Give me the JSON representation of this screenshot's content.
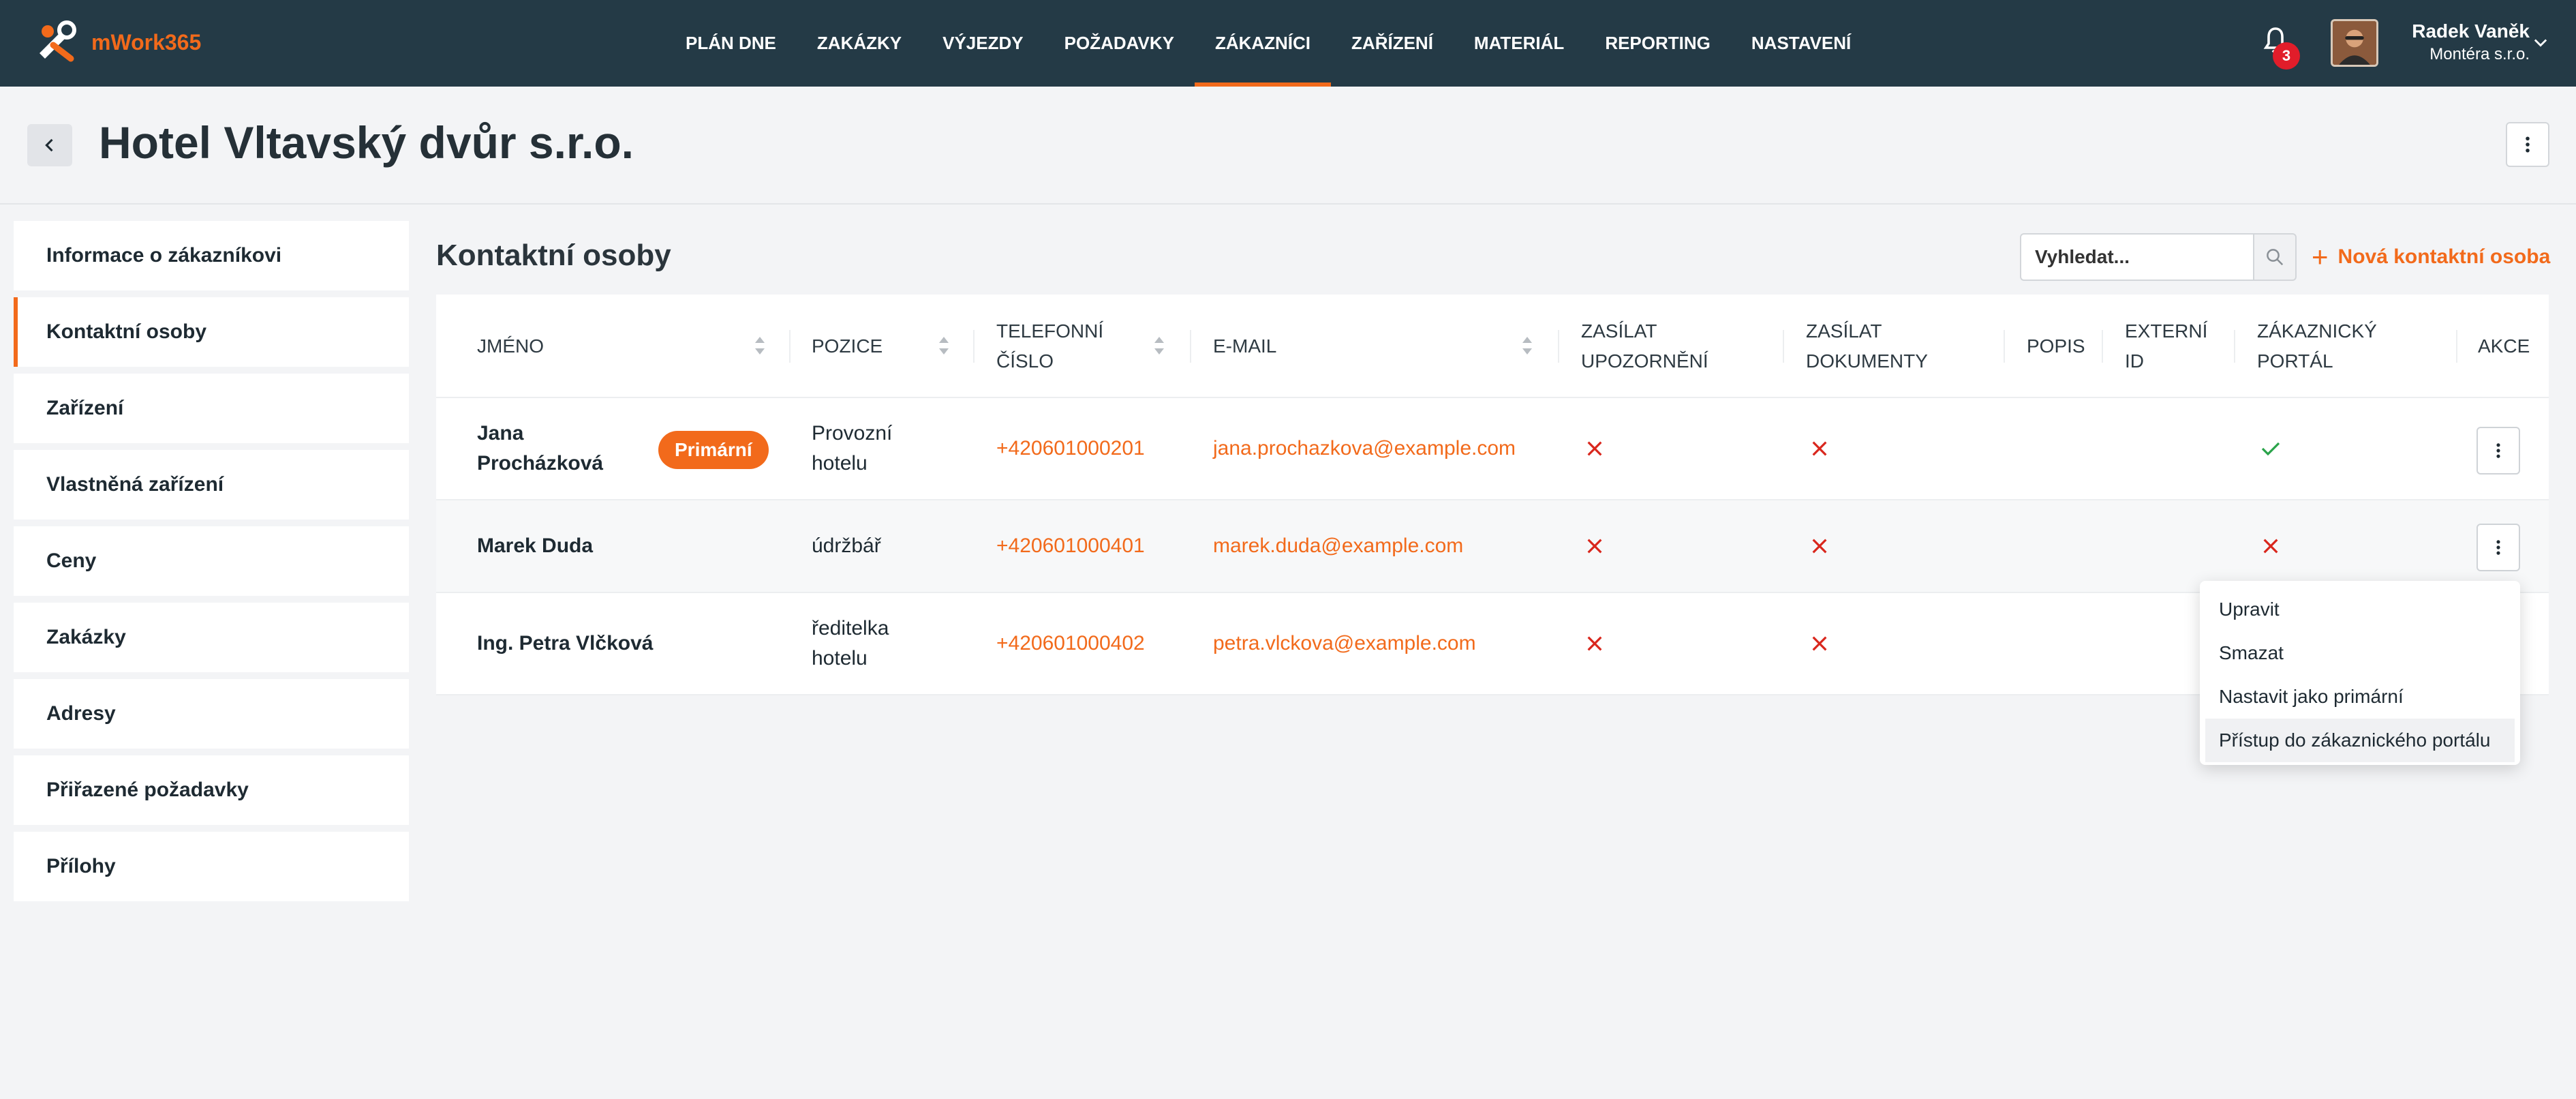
{
  "app": {
    "name": "mWork365",
    "brand_color": "#f26a1b",
    "nav_bg": "#243a46"
  },
  "nav": {
    "items": [
      {
        "label": "PLÁN DNE",
        "active": false
      },
      {
        "label": "ZAKÁZKY",
        "active": false
      },
      {
        "label": "VÝJEZDY",
        "active": false
      },
      {
        "label": "POŽADAVKY",
        "active": false
      },
      {
        "label": "ZÁKAZNÍCI",
        "active": true
      },
      {
        "label": "ZAŘÍZENÍ",
        "active": false
      },
      {
        "label": "MATERIÁL",
        "active": false
      },
      {
        "label": "REPORTING",
        "active": false
      },
      {
        "label": "NASTAVENÍ",
        "active": false
      }
    ],
    "notifications_count": "3",
    "user": {
      "name": "Radek Vaněk",
      "company": "Montéra s.r.o."
    }
  },
  "page": {
    "title": "Hotel Vltavský dvůr s.r.o."
  },
  "sidebar": {
    "items": [
      {
        "label": "Informace o zákazníkovi",
        "active": false
      },
      {
        "label": "Kontaktní osoby",
        "active": true
      },
      {
        "label": "Zařízení",
        "active": false
      },
      {
        "label": "Vlastněná zařízení",
        "active": false
      },
      {
        "label": "Ceny",
        "active": false
      },
      {
        "label": "Zakázky",
        "active": false
      },
      {
        "label": "Adresy",
        "active": false
      },
      {
        "label": "Přiřazené požadavky",
        "active": false
      },
      {
        "label": "Přílohy",
        "active": false
      }
    ]
  },
  "main": {
    "title": "Kontaktní osoby",
    "search_placeholder": "Vyhledat...",
    "new_button": "Nová kontaktní osoba"
  },
  "table": {
    "headers": {
      "name": "JMÉNO",
      "position": "POZICE",
      "phone_1": "TELEFONNÍ",
      "phone_2": "ČÍSLO",
      "email": "E-MAIL",
      "notify_1": "ZASÍLAT",
      "notify_2": "UPOZORNĚNÍ",
      "docs_1": "ZASÍLAT",
      "docs_2": "DOKUMENTY",
      "desc": "POPIS",
      "ext_1": "EXTERNÍ",
      "ext_2": "ID",
      "portal_1": "ZÁKAZNICKÝ",
      "portal_2": "PORTÁL",
      "actions": "AKCE"
    },
    "rows": [
      {
        "name_1": "Jana",
        "name_2": "Procházková",
        "badge": "Primární",
        "position_1": "Provozní",
        "position_2": "hotelu",
        "phone": "+420601000201",
        "email": "jana.prochazkova@example.com",
        "notify": false,
        "docs": false,
        "portal": true
      },
      {
        "name_1": "Marek Duda",
        "name_2": "",
        "badge": "",
        "position_1": "údržbář",
        "position_2": "",
        "phone": "+420601000401",
        "email": "marek.duda@example.com",
        "notify": false,
        "docs": false,
        "portal": false
      },
      {
        "name_1": "Ing. Petra Vlčková",
        "name_2": "",
        "badge": "",
        "position_1": "ředitelka",
        "position_2": "hotelu",
        "phone": "+420601000402",
        "email": "petra.vlckova@example.com",
        "notify": false,
        "docs": false,
        "portal": null
      }
    ]
  },
  "row_menu": {
    "items": [
      "Upravit",
      "Smazat",
      "Nastavit jako primární",
      "Přístup do zákaznického portálu"
    ],
    "highlighted_index": 3
  }
}
